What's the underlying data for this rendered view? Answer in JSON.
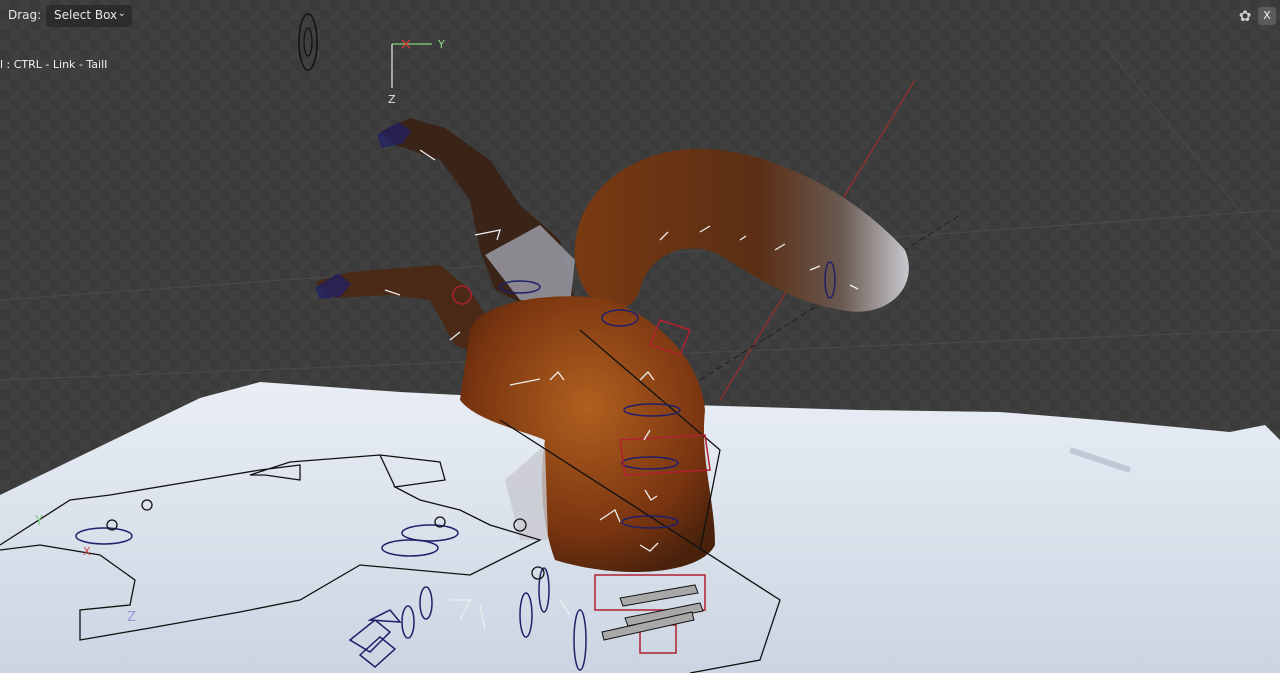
{
  "header": {
    "drag_label": "Drag:",
    "drag_mode": "Select Box",
    "close_label": "X"
  },
  "active_object": "l : CTRL - Link - TailI",
  "axes": {
    "x": "X",
    "y": "Y",
    "z": "Z"
  },
  "icons": {
    "butterfly": "butterfly-icon",
    "dropdown": "chevron-down-icon"
  },
  "colors": {
    "background": "#404040",
    "snow": "#dfe6ef",
    "fur": "#8a3f12",
    "rig_lines": "#111111",
    "bone_blue": "#20206a",
    "x_axis": "#d23a3a",
    "y_axis": "#7fd27f",
    "z_axis": "#ffffff"
  }
}
